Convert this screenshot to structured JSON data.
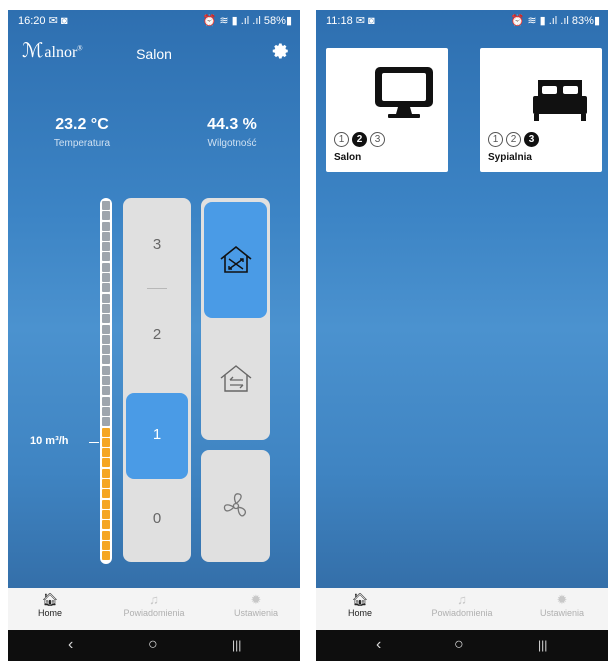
{
  "left": {
    "status": {
      "time": "16:20 ✉ ◙",
      "icons": "⏰ ≋ ▮ .ıl .ıl 58%▮"
    },
    "brand": "alnor",
    "title": "Salon",
    "temperature": {
      "value": "23.2 °C",
      "label": "Temperatura"
    },
    "humidity": {
      "value": "44.3 %",
      "label": "Wilgotność"
    },
    "flow_label": "10 m³/h",
    "flow_level": 0.36,
    "levels": [
      "3",
      "2",
      "1",
      "0"
    ],
    "active_level": "1",
    "nav": {
      "home": "Home",
      "notifications": "Powiadomienia",
      "settings": "Ustawienia"
    },
    "icons": [
      "gear-icon",
      "house-cross-icon",
      "house-arrows-icon",
      "fan-icon"
    ]
  },
  "right": {
    "status": {
      "time": "11:18 ✉ ◙",
      "icons": "⏰ ≋ ▮ .ıl .ıl 83%▮"
    },
    "rooms": [
      {
        "name": "Salon",
        "icon": "tv-icon",
        "levels": [
          "1",
          "2",
          "3"
        ],
        "selected": "2"
      },
      {
        "name": "Sypialnia",
        "icon": "bed-icon",
        "levels": [
          "1",
          "2",
          "3"
        ],
        "selected": "3"
      }
    ],
    "nav": {
      "home": "Home",
      "notifications": "Powiadomienia",
      "settings": "Ustawienia"
    }
  },
  "system_nav": {
    "back": "‹",
    "home": "○",
    "recents": "|||"
  },
  "colors": {
    "accent": "#4a9be6",
    "scale_on": "#f5a623",
    "scale_off": "#9ea5ad"
  }
}
